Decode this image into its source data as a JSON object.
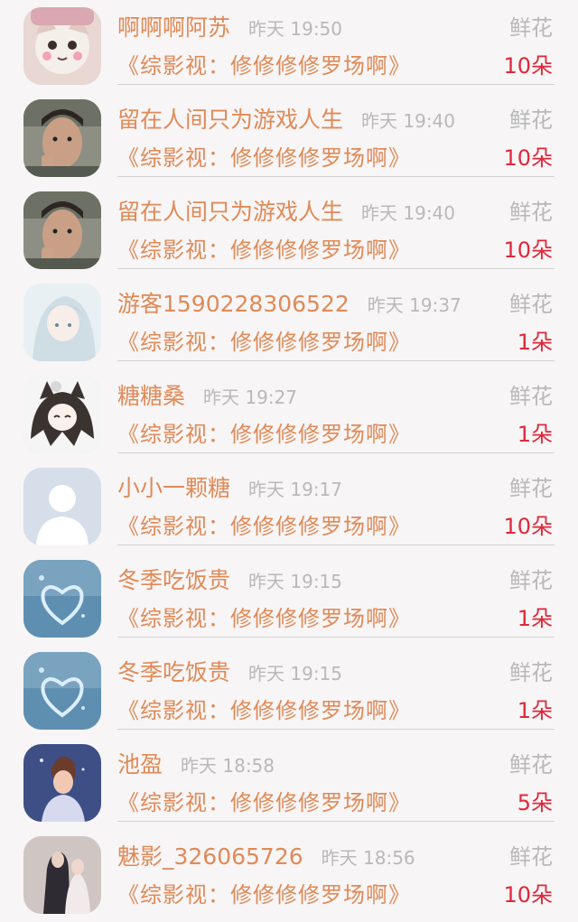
{
  "gifts": [
    {
      "name": "啊啊啊阿苏",
      "time": "昨天 19:50",
      "type": "鲜花",
      "book": "《综影视：修修修修罗场啊》",
      "count": "10朵",
      "avatar": "cat-avatar"
    },
    {
      "name": "留在人间只为游戏人生",
      "time": "昨天 19:40",
      "type": "鲜花",
      "book": "《综影视：修修修修罗场啊》",
      "count": "10朵",
      "avatar": "boy-photo-avatar"
    },
    {
      "name": "留在人间只为游戏人生",
      "time": "昨天 19:40",
      "type": "鲜花",
      "book": "《综影视：修修修修罗场啊》",
      "count": "10朵",
      "avatar": "boy-photo-avatar"
    },
    {
      "name": "游客1590228306522",
      "time": "昨天 19:37",
      "type": "鲜花",
      "book": "《综影视：修修修修罗场啊》",
      "count": "1朵",
      "avatar": "anime-girl-avatar"
    },
    {
      "name": "糖糖桑",
      "time": "昨天 19:27",
      "type": "鲜花",
      "book": "《综影视：修修修修罗场啊》",
      "count": "1朵",
      "avatar": "anime-catgirl-avatar"
    },
    {
      "name": "小小一颗糖",
      "time": "昨天 19:17",
      "type": "鲜花",
      "book": "《综影视：修修修修罗场啊》",
      "count": "10朵",
      "avatar": "default-avatar"
    },
    {
      "name": "冬季吃饭贵",
      "time": "昨天 19:15",
      "type": "鲜花",
      "book": "《综影视：修修修修罗场啊》",
      "count": "1朵",
      "avatar": "blue-heart-avatar"
    },
    {
      "name": "冬季吃饭贵",
      "time": "昨天 19:15",
      "type": "鲜花",
      "book": "《综影视：修修修修罗场啊》",
      "count": "1朵",
      "avatar": "blue-heart-avatar"
    },
    {
      "name": "池盈",
      "time": "昨天 18:58",
      "type": "鲜花",
      "book": "《综影视：修修修修罗场啊》",
      "count": "5朵",
      "avatar": "painted-girl-avatar"
    },
    {
      "name": "魅影_326065726",
      "time": "昨天 18:56",
      "type": "鲜花",
      "book": "《综影视：修修修修罗场啊》",
      "count": "10朵",
      "avatar": "couple-avatar"
    }
  ]
}
